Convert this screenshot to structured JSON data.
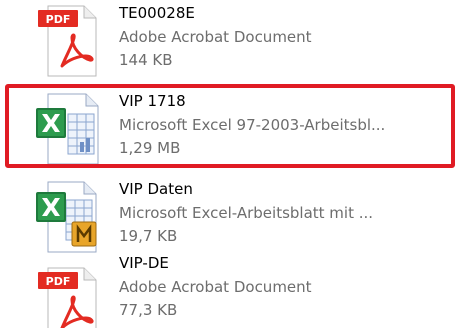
{
  "files": [
    {
      "name": "TE00028E",
      "type": "Adobe Acrobat Document",
      "size": "144 KB",
      "icon": "pdf-icon",
      "badge": "PDF"
    },
    {
      "name": "VIP 1718",
      "type": "Microsoft Excel 97-2003-Arbeitsbl...",
      "size": "1,29 MB",
      "icon": "excel-97-2003-icon"
    },
    {
      "name": "VIP Daten",
      "type": "Microsoft Excel-Arbeitsblatt mit ...",
      "size": "19,7 KB",
      "icon": "excel-macro-icon"
    },
    {
      "name": "VIP-DE",
      "type": "Adobe Acrobat Document",
      "size": "77,3 KB",
      "icon": "pdf-icon",
      "badge": "PDF"
    }
  ],
  "colors": {
    "highlight": "#e01b24",
    "pdf_badge": "#e32b22",
    "excel_green": "#1e7a3c",
    "secondary_text": "#6d6d6d"
  }
}
